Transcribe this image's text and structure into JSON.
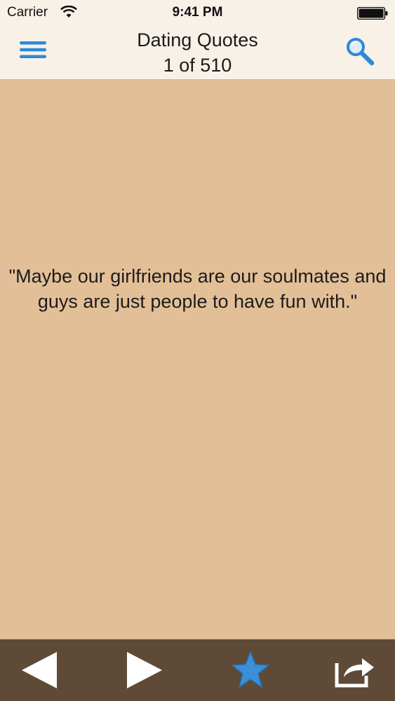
{
  "status_bar": {
    "carrier": "Carrier",
    "time": "9:41 PM"
  },
  "nav": {
    "title": "Dating Quotes",
    "subtitle": "1 of 510",
    "menu_icon": "hamburger-menu-icon",
    "search_icon": "search-icon"
  },
  "quote": {
    "text": "\"Maybe our girlfriends are our soulmates and guys are just people to have fun with.\""
  },
  "toolbar": {
    "icons": [
      "previous-arrow-icon",
      "next-arrow-icon",
      "favorite-star-icon",
      "share-icon"
    ]
  },
  "colors": {
    "background": "#e3bf97",
    "bar_background": "#f7f1e8",
    "toolbar_background": "#5e4a36",
    "accent_blue": "#2e89d6"
  }
}
